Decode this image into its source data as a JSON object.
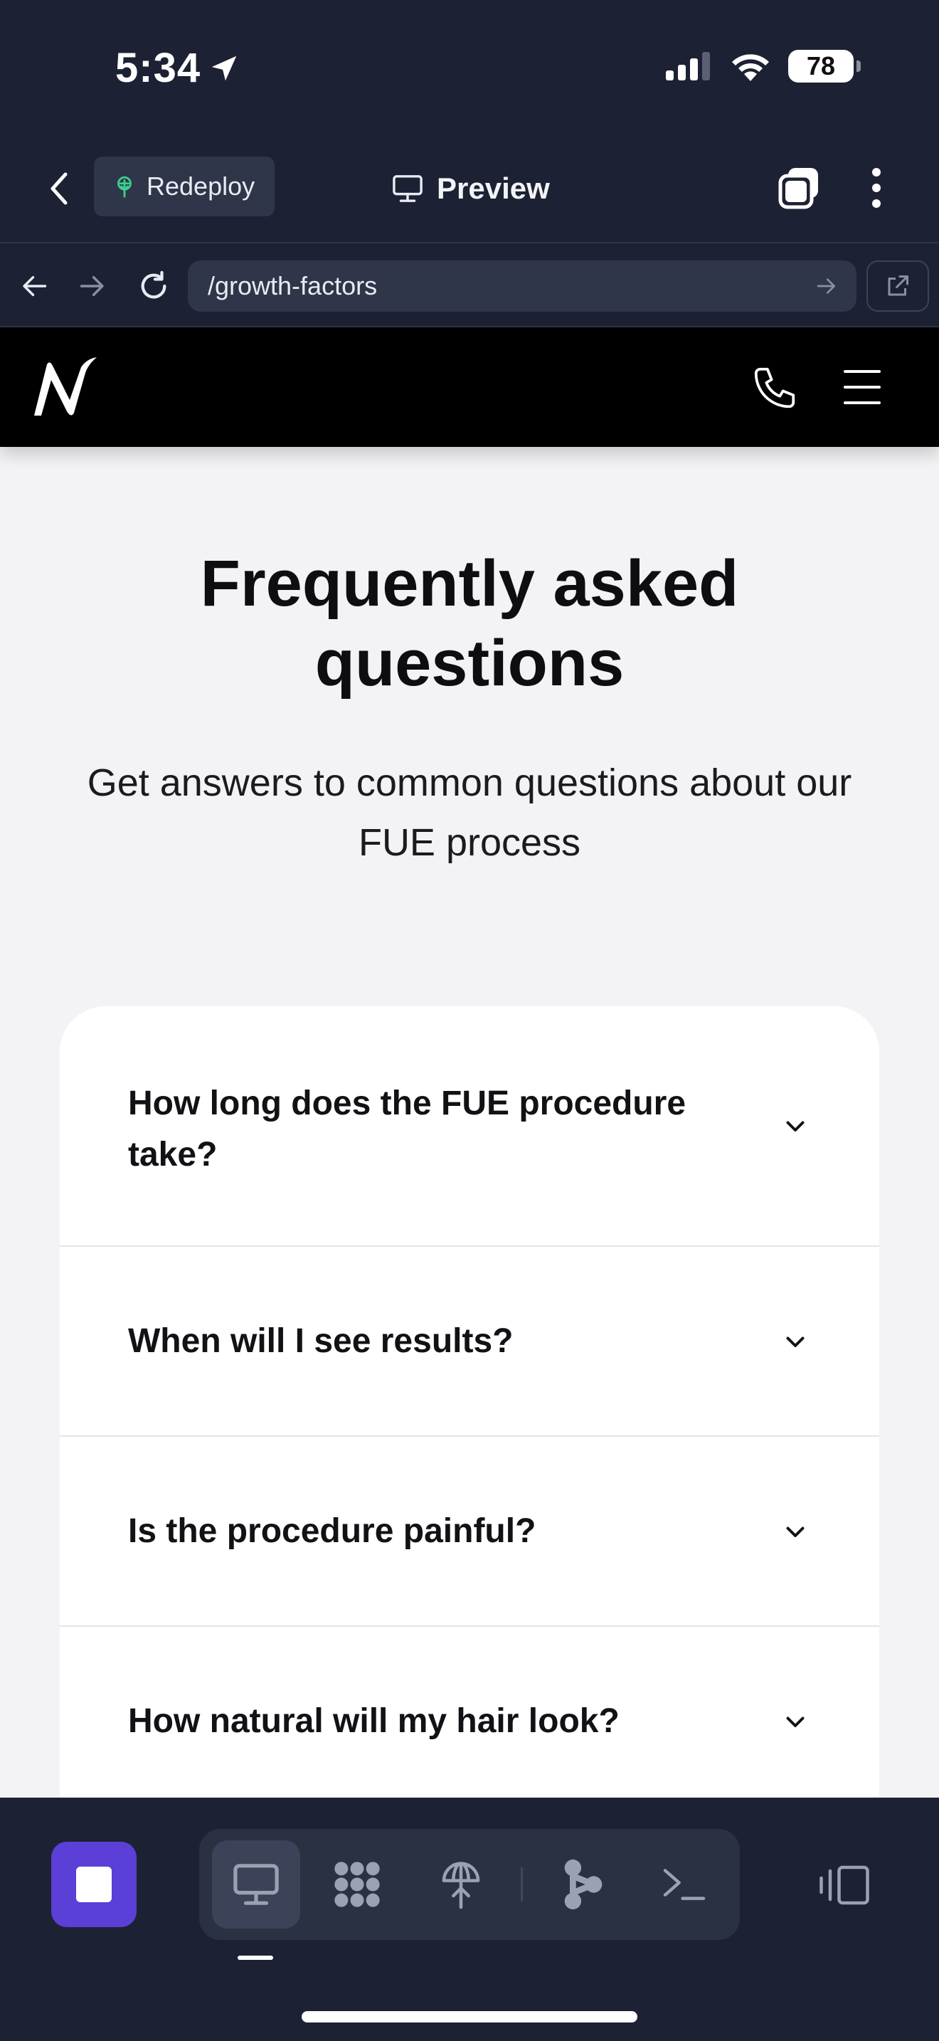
{
  "status_bar": {
    "time": "5:34",
    "battery": "78"
  },
  "toolbar": {
    "redeploy_label": "Redeploy",
    "preview_label": "Preview"
  },
  "url_bar": {
    "url": "/growth-factors"
  },
  "faq": {
    "heading": "Frequently asked questions",
    "subtitle": "Get answers to common questions about our FUE process",
    "items": [
      {
        "question": "How long does the FUE procedure take?"
      },
      {
        "question": "When will I see results?"
      },
      {
        "question": "Is the procedure painful?"
      },
      {
        "question": "How natural will my hair look?"
      }
    ]
  },
  "colors": {
    "app_bg": "#1c2233",
    "pill_bg": "#2f3649",
    "page_bg": "#f3f3f5",
    "site_header": "#000000",
    "stop_button": "#5b3fd6",
    "redeploy_icon": "#3ecf8e"
  },
  "icons": {
    "status": [
      "location-arrow-icon",
      "signal-icon",
      "wifi-icon",
      "battery-icon"
    ],
    "toolbar": [
      "back-chevron-icon",
      "redeploy-icon",
      "monitor-icon",
      "tabs-icon",
      "more-vertical-icon"
    ],
    "url_bar": [
      "back-arrow-icon",
      "forward-arrow-icon",
      "reload-icon",
      "go-arrow-icon",
      "external-link-icon"
    ],
    "site": [
      "logo-icon",
      "phone-icon",
      "menu-icon",
      "chevron-down-icon"
    ],
    "dock": [
      "stop-icon",
      "monitor-icon",
      "grid-icon",
      "globe-antenna-icon",
      "share-nodes-icon",
      "terminal-icon",
      "panel-toggle-icon"
    ]
  }
}
